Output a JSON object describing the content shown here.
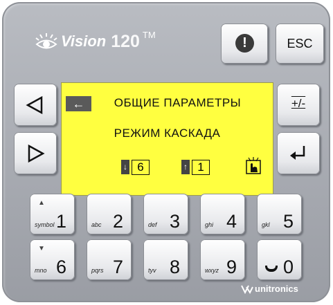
{
  "brand": {
    "logo_word": "Vision",
    "model": "120",
    "trademark": "TM",
    "maker": "unitronics"
  },
  "top_keys": {
    "info_label": "!",
    "esc_label": "ESC"
  },
  "side_keys": {
    "left_arrow": "◀",
    "right_arrow": "▶",
    "plus_minus": "+/-",
    "enter": "↵"
  },
  "lcd": {
    "line1": "ОБЩИЕ  ПАРАМЕТРЫ",
    "line2": "РЕЖИМ  КАСКАДА",
    "down_value": "6",
    "up_value": "1",
    "back_arrow": "←"
  },
  "keypad": [
    {
      "small": "symbol",
      "big": "1",
      "arrow": "▲"
    },
    {
      "small": "abc",
      "big": "2",
      "arrow": ""
    },
    {
      "small": "def",
      "big": "3",
      "arrow": ""
    },
    {
      "small": "ghi",
      "big": "4",
      "arrow": ""
    },
    {
      "small": "gkl",
      "big": "5",
      "arrow": ""
    },
    {
      "small": "mno",
      "big": "6",
      "arrow": "▼"
    },
    {
      "small": "pqrs",
      "big": "7",
      "arrow": ""
    },
    {
      "small": "tyv",
      "big": "8",
      "arrow": ""
    },
    {
      "small": "wxyz",
      "big": "9",
      "arrow": ""
    },
    {
      "small": "",
      "big": "0",
      "arrow": ""
    }
  ],
  "colors": {
    "panel": "#a9acb2",
    "lcd": "#ffff40",
    "key": "#f2f2f4"
  }
}
